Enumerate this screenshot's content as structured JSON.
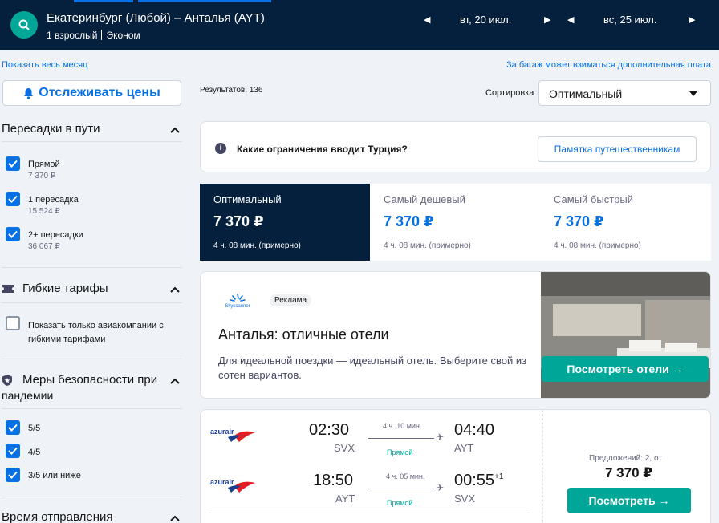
{
  "header": {
    "route": "Екатеринбург (Любой) – Анталья (AYT)",
    "passengers": "1 взрослый",
    "cabin": "Эконом",
    "depart_date": "вт, 20 июл.",
    "return_date": "вс, 25 июл."
  },
  "links": {
    "show_month": "Показать весь месяц",
    "baggage_fee": "За багаж может взиматься дополнительная плата"
  },
  "track_prices": "Отслеживать цены",
  "filters": {
    "stops": {
      "title": "Пересадки в пути",
      "options": [
        {
          "label": "Прямой",
          "price": "7 370 ₽"
        },
        {
          "label": "1 пересадка",
          "price": "15 524 ₽"
        },
        {
          "label": "2+ пересадки",
          "price": "36 067 ₽"
        }
      ]
    },
    "flex": {
      "title": "Гибкие тарифы",
      "option": "Показать только авиакомпании с гибкими тарифами"
    },
    "safety": {
      "title_line1": "Меры безопасности при",
      "title_line2": "пандемии",
      "options": [
        "5/5",
        "4/5",
        "3/5 или ниже"
      ]
    },
    "departure": {
      "title": "Время отправления"
    }
  },
  "results_count": "Результатов: 136",
  "sort": {
    "label": "Сортировка",
    "value": "Оптимальный"
  },
  "info": {
    "question": "Какие ограничения вводит Турция?",
    "button": "Памятка путешественникам"
  },
  "tabs": [
    {
      "name": "Оптимальный",
      "price": "7 370 ₽",
      "duration": "4 ч. 08 мин. (примерно)"
    },
    {
      "name": "Самый дешевый",
      "price": "7 370 ₽",
      "duration": "4 ч. 08 мин. (примерно)"
    },
    {
      "name": "Самый быстрый",
      "price": "7 370 ₽",
      "duration": "4 ч. 08 мин. (примерно)"
    }
  ],
  "ad": {
    "logo_text": "Skyscanner",
    "badge": "Реклама",
    "title": "Анталья: отличные отели",
    "text": "Для идеальной поездки — идеальный отель. Выберите свой из сотен вариантов.",
    "button": "Посмотреть отели →"
  },
  "flight": {
    "airline_logo": "azurair",
    "legs": [
      {
        "dep_time": "02:30",
        "dep_ap": "SVX",
        "duration": "4 ч. 10 мин.",
        "type": "Прямой",
        "arr_time": "04:40",
        "arr_ap": "AYT",
        "plus": ""
      },
      {
        "dep_time": "18:50",
        "dep_ap": "AYT",
        "duration": "4 ч. 05 мин.",
        "type": "Прямой",
        "arr_time": "00:55",
        "arr_ap": "SVX",
        "plus": "+1"
      }
    ],
    "offers": "Предложений: 2, от",
    "price": "7 370 ₽",
    "button": "Посмотреть →"
  },
  "colors": {
    "navy": "#05203c",
    "blue": "#0770e3",
    "teal": "#00a698"
  }
}
